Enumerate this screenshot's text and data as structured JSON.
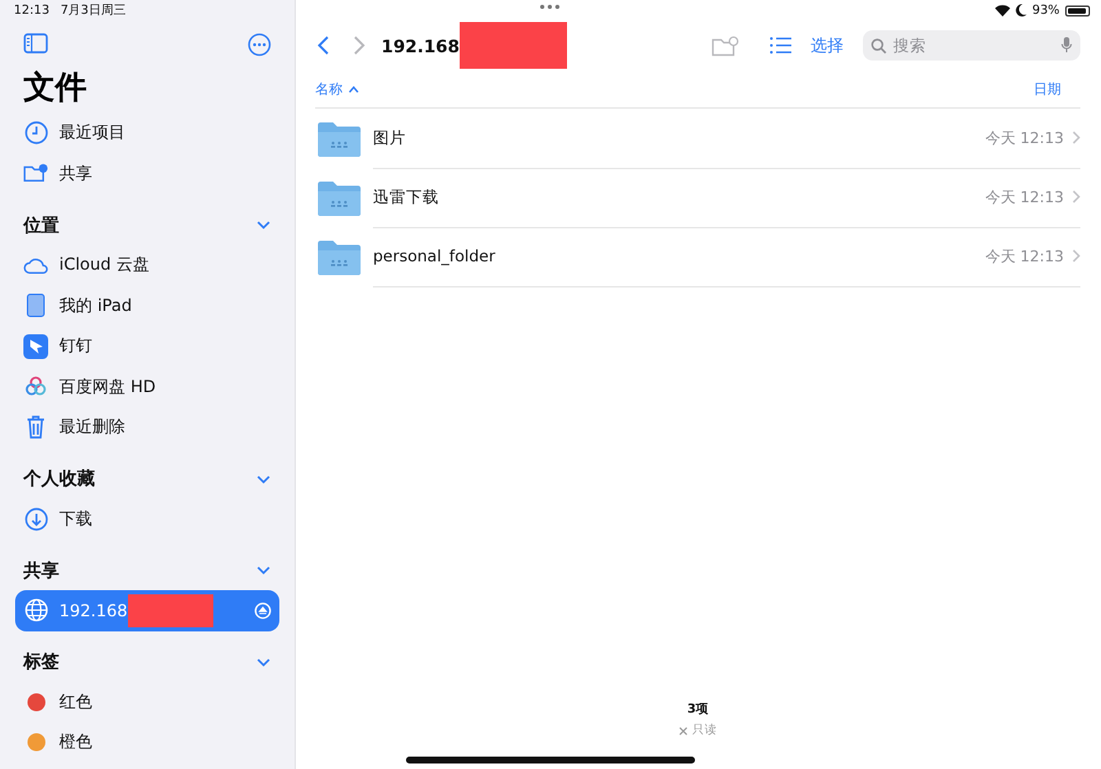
{
  "status_bar": {
    "time": "12:13",
    "date": "7月3日周三",
    "battery": "93%"
  },
  "sidebar": {
    "title": "文件",
    "items": [
      {
        "label": "最近项目",
        "kind": "clock",
        "selected": false
      },
      {
        "label": "共享",
        "kind": "shared-folder",
        "selected": false
      }
    ],
    "sections": [
      {
        "title": "位置",
        "expanded": true,
        "items": [
          {
            "label": "iCloud 云盘",
            "kind": "cloud",
            "selected": false
          },
          {
            "label": "我的 iPad",
            "kind": "ipad",
            "selected": false
          },
          {
            "label": "钉钉",
            "kind": "app",
            "selected": false
          },
          {
            "label": "百度网盘 HD",
            "kind": "app",
            "selected": false
          },
          {
            "label": "最近删除",
            "kind": "trash",
            "selected": false
          }
        ]
      },
      {
        "title": "个人收藏",
        "expanded": true,
        "items": [
          {
            "label": "下载",
            "kind": "download",
            "selected": false
          }
        ]
      },
      {
        "title": "共享",
        "expanded": true,
        "items": [
          {
            "label": "192.168",
            "kind": "server",
            "selected": true,
            "redacted": true,
            "eject": true
          }
        ]
      },
      {
        "title": "标签",
        "expanded": true,
        "items": [
          {
            "label": "红色",
            "kind": "tag",
            "color": "#e5483d",
            "selected": false
          },
          {
            "label": "橙色",
            "kind": "tag",
            "color": "#f09a37",
            "selected": false
          }
        ]
      }
    ]
  },
  "main": {
    "path": {
      "label": "192.168",
      "redacted": true
    },
    "toolbar": {
      "select": "选择",
      "search_placeholder": "搜索"
    },
    "columns": [
      {
        "label": "名称",
        "sorted": true
      },
      {
        "label": "日期",
        "sorted": false
      }
    ],
    "rows": [
      {
        "name": "图片",
        "date": "今天 12:13"
      },
      {
        "name": "迅雷下载",
        "date": "今天 12:13"
      },
      {
        "name": "personal_folder",
        "date": "今天 12:13"
      }
    ],
    "footer": {
      "count": "3项",
      "status": "只读"
    }
  }
}
